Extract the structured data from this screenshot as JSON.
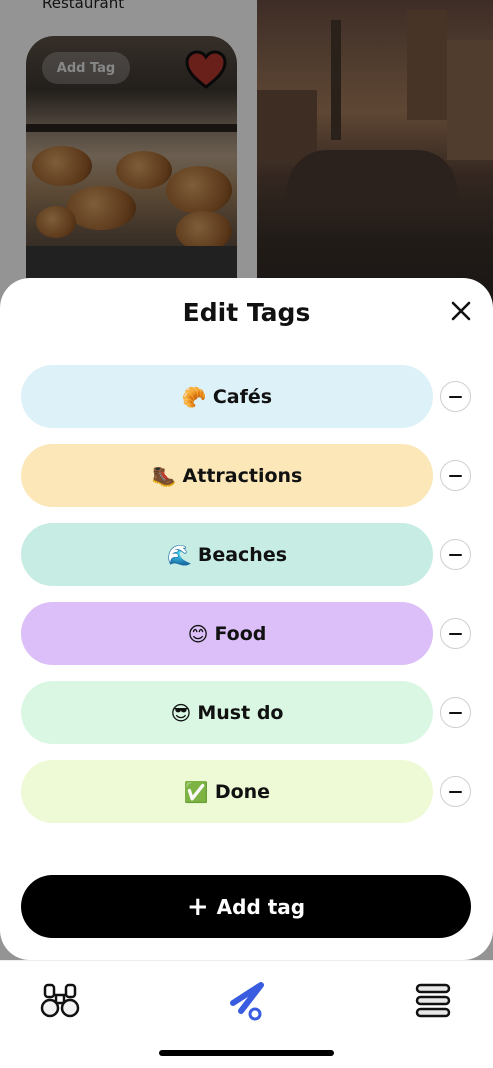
{
  "background": {
    "category_label": "Restaurant",
    "card_tag_label": "Add Tag"
  },
  "sheet": {
    "title": "Edit Tags",
    "tags": [
      {
        "emoji": "🥐",
        "label": "Cafés",
        "color": "#dcf1f8"
      },
      {
        "emoji": "🥾",
        "label": "Attractions",
        "color": "#fbe7b7"
      },
      {
        "emoji": "🌊",
        "label": "Beaches",
        "color": "#c6ece3"
      },
      {
        "emoji": "😊",
        "label": "Food",
        "color": "#dcbff8"
      },
      {
        "emoji": "😎",
        "label": "Must do",
        "color": "#daf7e4"
      },
      {
        "emoji": "✅",
        "label": "Done",
        "color": "#eefad6"
      }
    ],
    "add_button": {
      "icon": "+",
      "label": "Add tag"
    }
  },
  "nav": {
    "items": [
      "binoculars-icon",
      "route-icon",
      "menu-stack-icon"
    ],
    "accent": "#3a5ce0"
  }
}
